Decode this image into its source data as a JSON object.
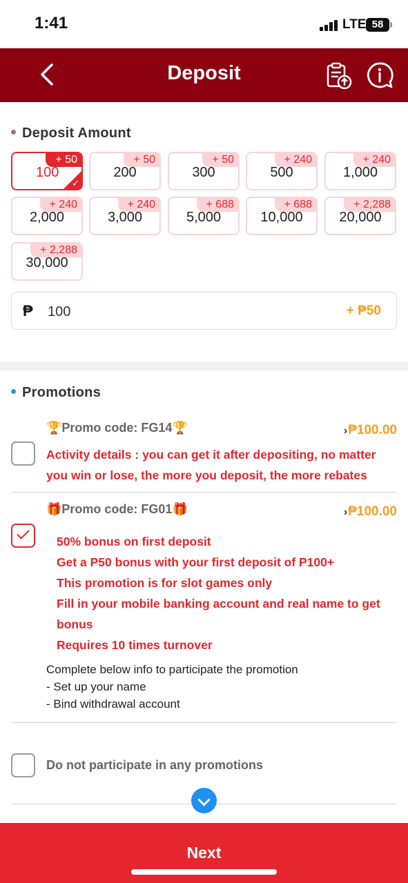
{
  "status_bar": {
    "time": "1:41",
    "network": "LTE",
    "battery": "58"
  },
  "header": {
    "title": "Deposit",
    "back_icon": "chevron-left-icon",
    "records_icon": "clipboard-upload-icon",
    "help_icon": "info-chat-icon",
    "bg_color": "#8c0010"
  },
  "deposit": {
    "section_title": "Deposit Amount",
    "amounts": [
      {
        "value": "100",
        "bonus": "+ 50",
        "selected": true
      },
      {
        "value": "200",
        "bonus": "+ 50"
      },
      {
        "value": "300",
        "bonus": "+ 50"
      },
      {
        "value": "500",
        "bonus": "+ 240"
      },
      {
        "value": "1,000",
        "bonus": "+ 240"
      },
      {
        "value": "2,000",
        "bonus": "+ 240"
      },
      {
        "value": "3,000",
        "bonus": "+ 240"
      },
      {
        "value": "5,000",
        "bonus": "+ 688"
      },
      {
        "value": "10,000",
        "bonus": "+ 688"
      },
      {
        "value": "20,000",
        "bonus": "+ 2,288"
      },
      {
        "value": "30,000",
        "bonus": "+ 2,288"
      }
    ],
    "currency_symbol": "₱",
    "input_value": "100",
    "input_bonus": "+ ₱50"
  },
  "promotions": {
    "section_title": "Promotions",
    "items": [
      {
        "title": "🏆Promo code: FG14🏆",
        "amount": "₱100.00",
        "checked": false,
        "text": "Activity details : you can get it after depositing, no matter you win or lose, the more you deposit, the more rebates you will get"
      },
      {
        "title": "🎁Promo code: FG01🎁",
        "amount": "₱100.00",
        "checked": true,
        "lines": [
          "50% bonus on first deposit",
          "Get a P50 bonus with your first deposit of P100+",
          "This promotion is for slot games only",
          "Fill in your mobile banking account and real name to get bonus",
          "Requires 10 times turnover"
        ],
        "note": [
          "Complete below info to participate the promotion",
          "- Set up your name",
          "- Bind withdrawal account"
        ]
      }
    ],
    "no_promo_label": "Do not participate in any promotions",
    "accent_color": "#e4262c"
  },
  "footer": {
    "next_label": "Next",
    "bg_color": "#e5262e"
  }
}
